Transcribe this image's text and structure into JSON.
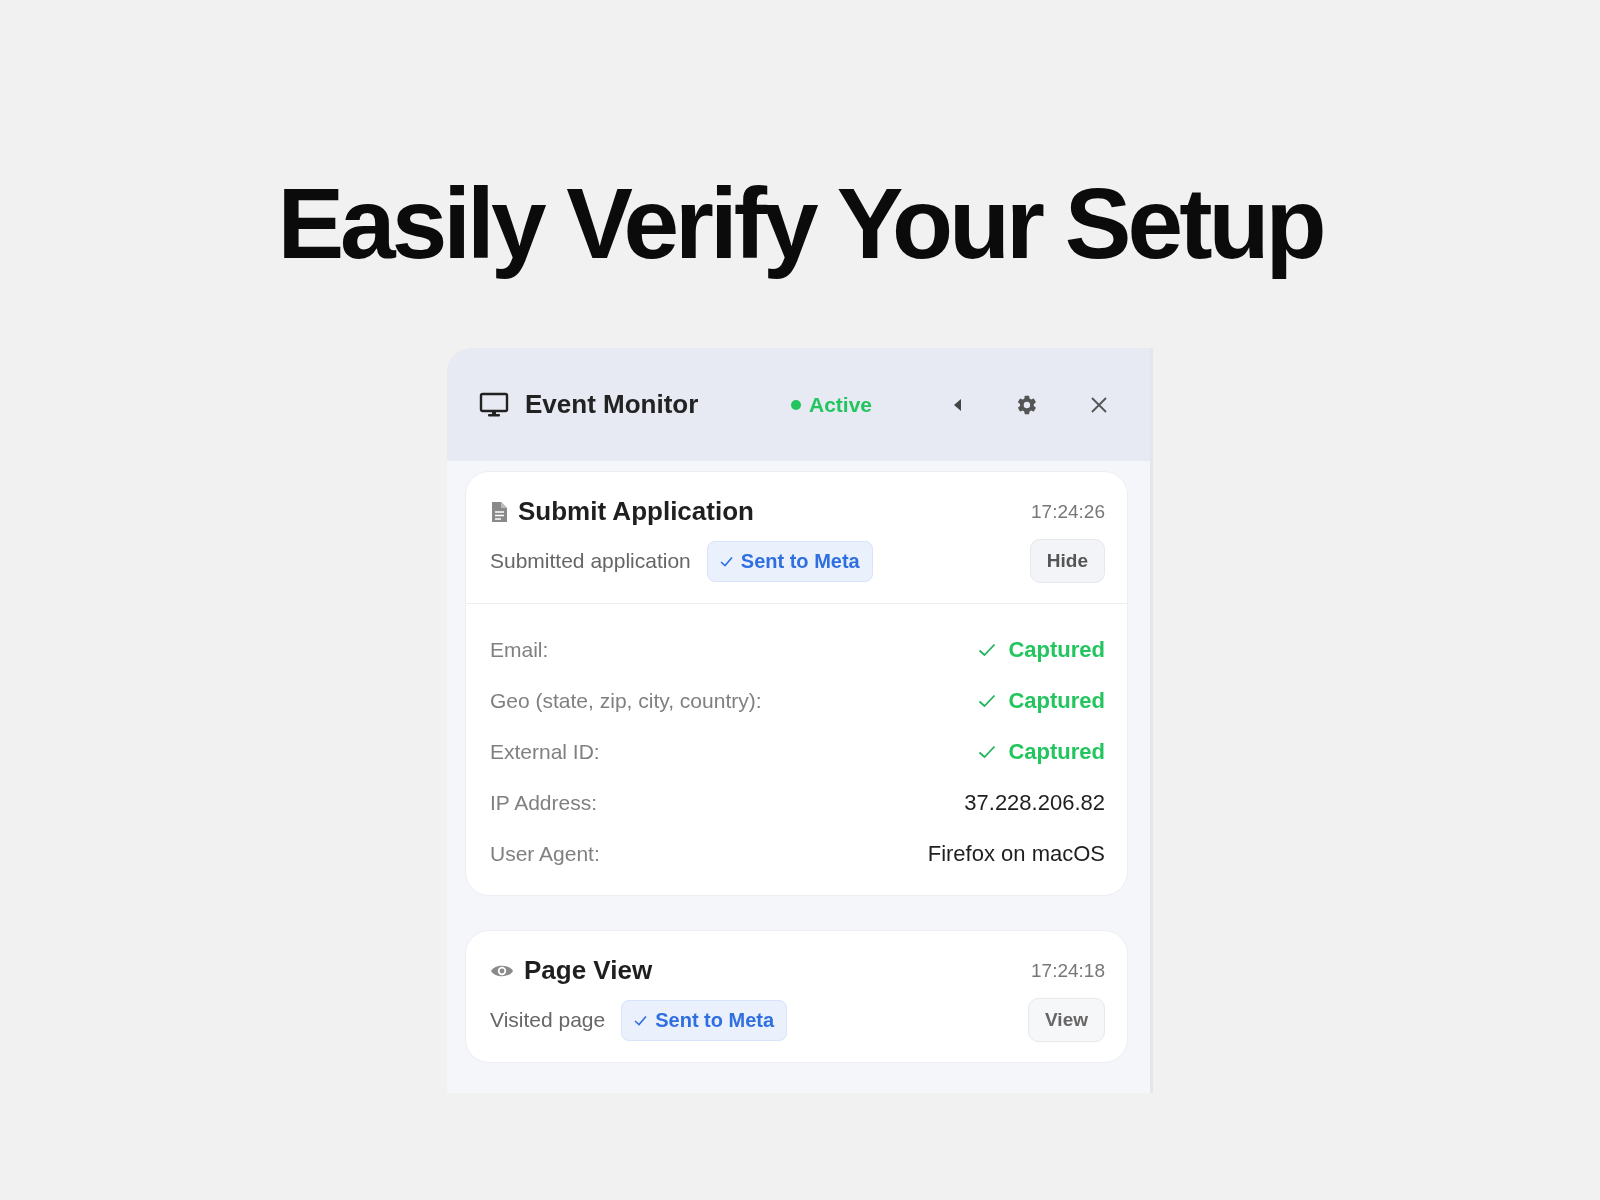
{
  "headline": "Easily Verify Your Setup",
  "monitor": {
    "title": "Event Monitor",
    "status": {
      "label": "Active",
      "active": true
    },
    "events": [
      {
        "kind": "document",
        "title": "Submit Application",
        "time": "17:24:26",
        "description": "Submitted application",
        "badge": "Sent to Meta",
        "button": "Hide",
        "expanded": true,
        "details": [
          {
            "label": "Email:",
            "kind": "captured",
            "value": "Captured"
          },
          {
            "label": "Geo (state, zip, city, country):",
            "kind": "captured",
            "value": "Captured"
          },
          {
            "label": "External ID:",
            "kind": "captured",
            "value": "Captured"
          },
          {
            "label": "IP Address:",
            "kind": "text",
            "value": "37.228.206.82"
          },
          {
            "label": "User Agent:",
            "kind": "text",
            "value": "Firefox on macOS"
          }
        ]
      },
      {
        "kind": "view",
        "title": "Page View",
        "time": "17:24:18",
        "description": "Visited page",
        "badge": "Sent to Meta",
        "button": "View",
        "expanded": false
      }
    ]
  }
}
